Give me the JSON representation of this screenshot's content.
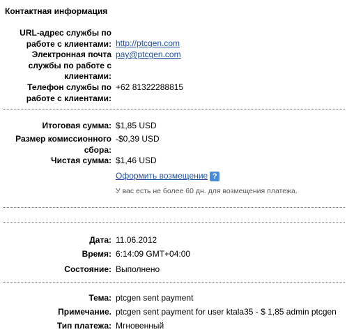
{
  "header": "Контактная информация",
  "contact": {
    "url_label": [
      "URL-адрес службы по",
      "работе с клиентами:"
    ],
    "url_value": "http://ptcgen.com",
    "email_label": [
      "Электронная почта",
      "службы по работе с",
      "клиентами:"
    ],
    "email_value": "pay@ptcgen.com",
    "phone_label": [
      "Телефон службы по",
      "работе с клиентами:"
    ],
    "phone_value": "+62 81322288815"
  },
  "amounts": {
    "total_label": "Итоговая сумма:",
    "total_value": "$1,85 USD",
    "fee_label": [
      "Размер комиссионного",
      "сбора:"
    ],
    "fee_value": "-$0,39 USD",
    "net_label": "Чистая сумма:",
    "net_value": "$1,46 USD",
    "refund_link": "Оформить возмещение",
    "help_icon": "?",
    "refund_note": "У вас есть не более 60 дн. для возмещения платежа."
  },
  "details": {
    "date_label": "Дата:",
    "date_value": "11.06.2012",
    "time_label": "Время:",
    "time_value": "6:14:09 GMT+04:00",
    "status_label": "Состояние:",
    "status_value": "Выполнено"
  },
  "message": {
    "subject_label": "Тема:",
    "subject_value": "ptcgen sent payment",
    "note_label": "Примечание.",
    "note_value": "ptcgen sent payment for user ktala35 - $ 1,85 admin ptcgen",
    "type_label": "Тип платежа:",
    "type_value": "Мгновенный"
  }
}
